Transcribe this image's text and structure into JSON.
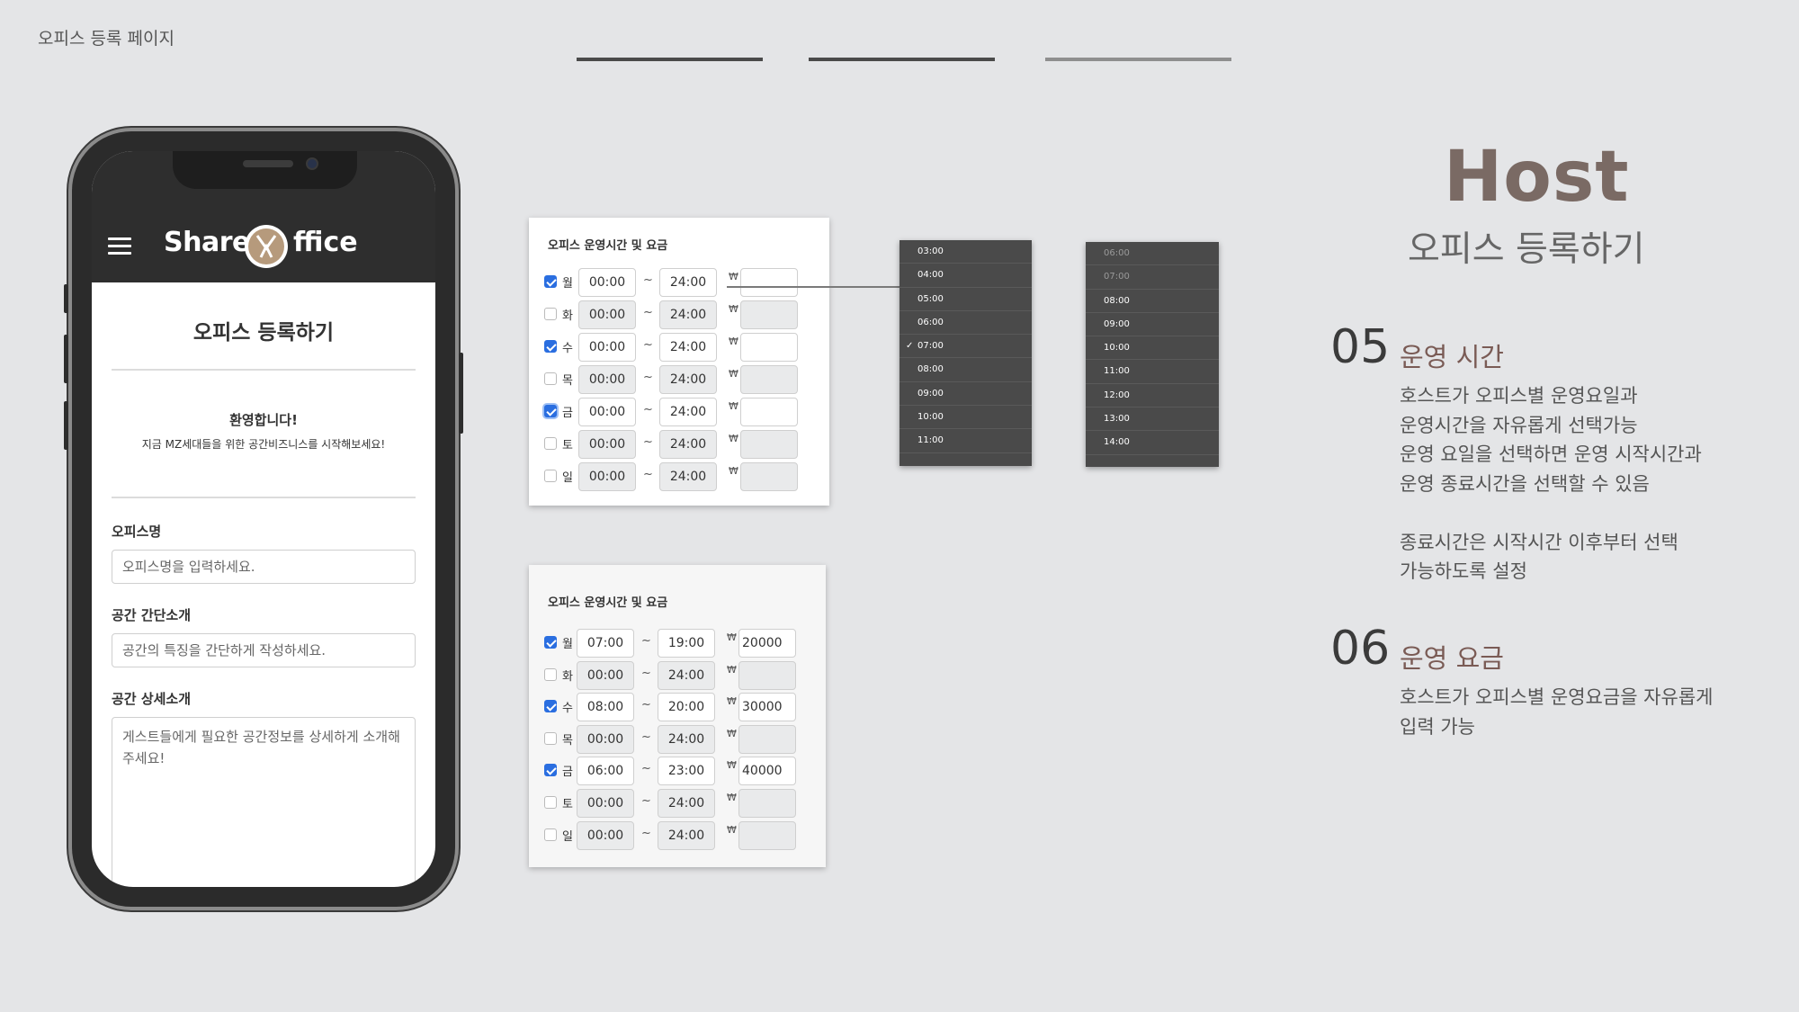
{
  "page_title": "오피스 등록 페이지",
  "phone": {
    "brand_left": "Share",
    "brand_right": "ffice",
    "form_title": "오피스 등록하기",
    "welcome": "환영합니다!",
    "welcome_sub": "지금 MZ세대들을 위한 공간비즈니스를 시작해보세요!",
    "office_name_label": "오피스명",
    "office_name_placeholder": "오피스명을 입력하세요.",
    "short_intro_label": "공간 간단소개",
    "short_intro_placeholder": "공간의 특징을 간단하게 작성하세요.",
    "detail_intro_label": "공간 상세소개",
    "detail_intro_placeholder": "게스트들에게 필요한 공간정보를 상세하게 소개해주세요!"
  },
  "schedule_before": {
    "title": "오피스 운영시간 및 요금",
    "rows": [
      {
        "day": "월",
        "checked": true,
        "start": "00:00",
        "end": "24:00",
        "price": ""
      },
      {
        "day": "화",
        "checked": false,
        "start": "00:00",
        "end": "24:00",
        "price": ""
      },
      {
        "day": "수",
        "checked": true,
        "start": "00:00",
        "end": "24:00",
        "price": ""
      },
      {
        "day": "목",
        "checked": false,
        "start": "00:00",
        "end": "24:00",
        "price": ""
      },
      {
        "day": "금",
        "checked": true,
        "start": "00:00",
        "end": "24:00",
        "price": ""
      },
      {
        "day": "토",
        "checked": false,
        "start": "00:00",
        "end": "24:00",
        "price": ""
      },
      {
        "day": "일",
        "checked": false,
        "start": "00:00",
        "end": "24:00",
        "price": ""
      }
    ],
    "currency": "₩",
    "separator": "~"
  },
  "schedule_after": {
    "title": "오피스 운영시간 및 요금",
    "rows": [
      {
        "day": "월",
        "checked": true,
        "start": "07:00",
        "end": "19:00",
        "price": "20000"
      },
      {
        "day": "화",
        "checked": false,
        "start": "00:00",
        "end": "24:00",
        "price": ""
      },
      {
        "day": "수",
        "checked": true,
        "start": "08:00",
        "end": "20:00",
        "price": "30000"
      },
      {
        "day": "목",
        "checked": false,
        "start": "00:00",
        "end": "24:00",
        "price": ""
      },
      {
        "day": "금",
        "checked": true,
        "start": "06:00",
        "end": "23:00",
        "price": "40000"
      },
      {
        "day": "토",
        "checked": false,
        "start": "00:00",
        "end": "24:00",
        "price": ""
      },
      {
        "day": "일",
        "checked": false,
        "start": "00:00",
        "end": "24:00",
        "price": ""
      }
    ],
    "currency": "₩",
    "separator": "~"
  },
  "start_dropdown": {
    "options": [
      "03:00",
      "04:00",
      "05:00",
      "06:00",
      "07:00",
      "08:00",
      "09:00",
      "10:00",
      "11:00"
    ],
    "selected": "07:00",
    "check_mark": "✓"
  },
  "end_dropdown": {
    "options": [
      "06:00",
      "07:00",
      "08:00",
      "09:00",
      "10:00",
      "11:00",
      "12:00",
      "13:00",
      "14:00"
    ],
    "disabled": [
      "06:00",
      "07:00"
    ]
  },
  "panel": {
    "host": "Host",
    "subtitle": "오피스 등록하기",
    "sections": [
      {
        "number": "05",
        "title": "운영 시간",
        "body": "호스트가 오피스별 운영요일과\n운영시간을 자유롭게 선택가능\n운영 요일을 선택하면 운영 시작시간과\n운영 종료시간을 선택할 수 있음\n\n종료시간은  시작시간 이후부터 선택\n가능하도록 설정"
      },
      {
        "number": "06",
        "title": "운영 요금",
        "body": "호스트가 오피스별 운영요금을 자유롭게\n입력 가능"
      }
    ]
  },
  "colors": {
    "background": "#e4e5e7",
    "accent": "#7a6a64",
    "checkbox": "#2a6ee0"
  }
}
